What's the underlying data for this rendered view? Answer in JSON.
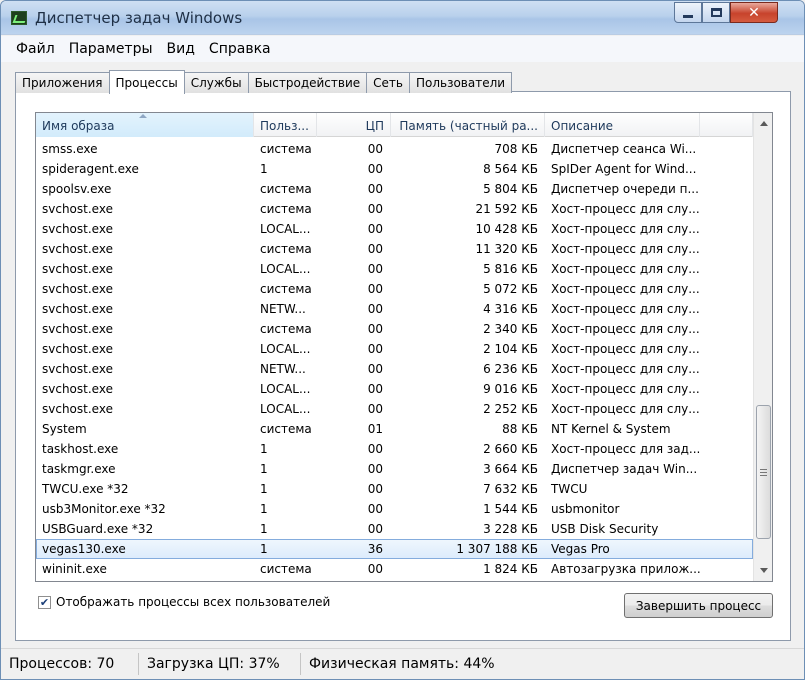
{
  "window": {
    "title": "Диспетчер задач Windows",
    "close_glyph": "✕"
  },
  "menu": [
    "Файл",
    "Параметры",
    "Вид",
    "Справка"
  ],
  "tabs": [
    "Приложения",
    "Процессы",
    "Службы",
    "Быстродействие",
    "Сеть",
    "Пользователи"
  ],
  "active_tab": "Процессы",
  "table": {
    "columns": [
      "Имя образа",
      "Польз...",
      "ЦП",
      "Память (частный ра...",
      "Описание",
      ""
    ],
    "rows": [
      [
        "smss.exe",
        "система",
        "00",
        "708 КБ",
        "Диспетчер сеанса  Wi..."
      ],
      [
        "spideragent.exe",
        "1",
        "00",
        "8 564 КБ",
        "SpIDer Agent for Wind..."
      ],
      [
        "spoolsv.exe",
        "система",
        "00",
        "5 804 КБ",
        "Диспетчер очереди п..."
      ],
      [
        "svchost.exe",
        "система",
        "00",
        "21 592 КБ",
        "Хост-процесс для слу..."
      ],
      [
        "svchost.exe",
        "LOCAL...",
        "00",
        "10 428 КБ",
        "Хост-процесс для слу..."
      ],
      [
        "svchost.exe",
        "система",
        "00",
        "11 320 КБ",
        "Хост-процесс для слу..."
      ],
      [
        "svchost.exe",
        "LOCAL...",
        "00",
        "5 816 КБ",
        "Хост-процесс для слу..."
      ],
      [
        "svchost.exe",
        "система",
        "00",
        "5 072 КБ",
        "Хост-процесс для слу..."
      ],
      [
        "svchost.exe",
        "NETW...",
        "00",
        "4 316 КБ",
        "Хост-процесс для слу..."
      ],
      [
        "svchost.exe",
        "система",
        "00",
        "2 340 КБ",
        "Хост-процесс для слу..."
      ],
      [
        "svchost.exe",
        "LOCAL...",
        "00",
        "2 104 КБ",
        "Хост-процесс для слу..."
      ],
      [
        "svchost.exe",
        "NETW...",
        "00",
        "6 236 КБ",
        "Хост-процесс для слу..."
      ],
      [
        "svchost.exe",
        "LOCAL...",
        "00",
        "9 016 КБ",
        "Хост-процесс для слу..."
      ],
      [
        "svchost.exe",
        "LOCAL...",
        "00",
        "2 252 КБ",
        "Хост-процесс для слу..."
      ],
      [
        "System",
        "система",
        "01",
        "88 КБ",
        "NT Kernel & System"
      ],
      [
        "taskhost.exe",
        "1",
        "00",
        "2 660 КБ",
        "Хост-процесс для зад..."
      ],
      [
        "taskmgr.exe",
        "1",
        "00",
        "3 664 КБ",
        "Диспетчер задач Win..."
      ],
      [
        "TWCU.exe *32",
        "1",
        "00",
        "7 632 КБ",
        "TWCU"
      ],
      [
        "usb3Monitor.exe *32",
        "1",
        "00",
        "1 544 КБ",
        "usbmonitor"
      ],
      [
        "USBGuard.exe *32",
        "1",
        "00",
        "3 228 КБ",
        "USB Disk Security"
      ],
      [
        "vegas130.exe",
        "1",
        "36",
        "1 307 188 КБ",
        "Vegas Pro"
      ],
      [
        "wininit.exe",
        "система",
        "00",
        "1 824 КБ",
        "Автозагрузка прилож..."
      ]
    ],
    "selected_row": 20
  },
  "checkbox": {
    "label": "Отображать процессы всех пользователей",
    "checked": true,
    "mark": "✔"
  },
  "end_button": "Завершить процесс",
  "status": {
    "processes": "Процессов: 70",
    "cpu": "Загрузка ЦП: 37%",
    "memory": "Физическая память: 44%"
  }
}
